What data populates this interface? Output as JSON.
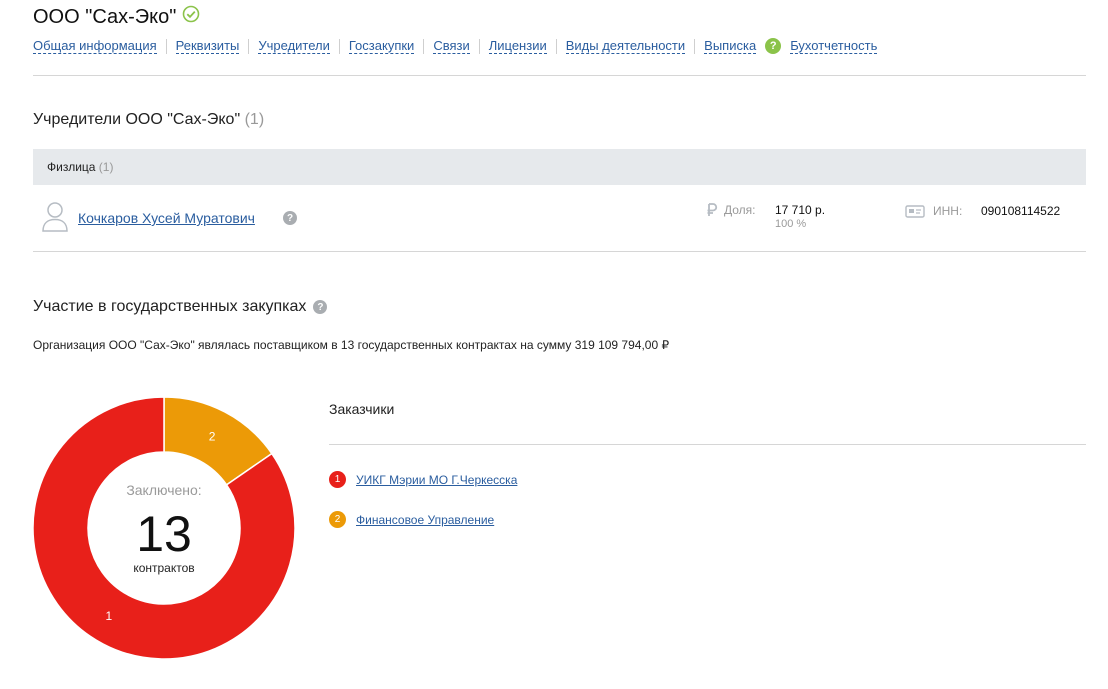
{
  "company": {
    "title": "ООО \"Сах-Эко\""
  },
  "nav": {
    "items": [
      "Общая информация",
      "Реквизиты",
      "Учредители",
      "Госзакупки",
      "Связи",
      "Лицензии",
      "Виды деятельности",
      "Выписка"
    ],
    "help_glyph": "?",
    "last": "Бухотчетность"
  },
  "founders": {
    "heading": "Учредители ООО \"Сах-Эко\"",
    "count": "(1)",
    "group_label": "Физлица",
    "group_count": "(1)",
    "person": {
      "name": "Кочкаров Хусей Муратович",
      "share_label": "Доля:",
      "share_value": "17 710 р.",
      "share_percent": "100 %",
      "inn_label": "ИНН:",
      "inn_value": "090108114522"
    }
  },
  "procurement": {
    "heading": "Участие в государственных закупках",
    "description": "Организация ООО \"Сах-Эко\" являлась поставщиком в 13 государственных контрактах на сумму 319 109 794,00 ₽",
    "center_label": "Заключено:",
    "center_value": "13",
    "center_unit": "контрактов",
    "customers_title": "Заказчики",
    "customers": [
      {
        "index": "1",
        "name": "УИКГ Мэрии МО Г.Черкесска",
        "value": 11,
        "color": "#e8201a"
      },
      {
        "index": "2",
        "name": "Финансовое Управление",
        "value": 2,
        "color": "#ec9a07"
      }
    ]
  },
  "chart_data": {
    "type": "pie",
    "categories": [
      "УИКГ Мэрии МО Г.Черкесска",
      "Финансовое Управление"
    ],
    "values": [
      11,
      2
    ],
    "slice_labels": [
      "1",
      "2"
    ],
    "colors": [
      "#e8201a",
      "#ec9a07"
    ]
  }
}
